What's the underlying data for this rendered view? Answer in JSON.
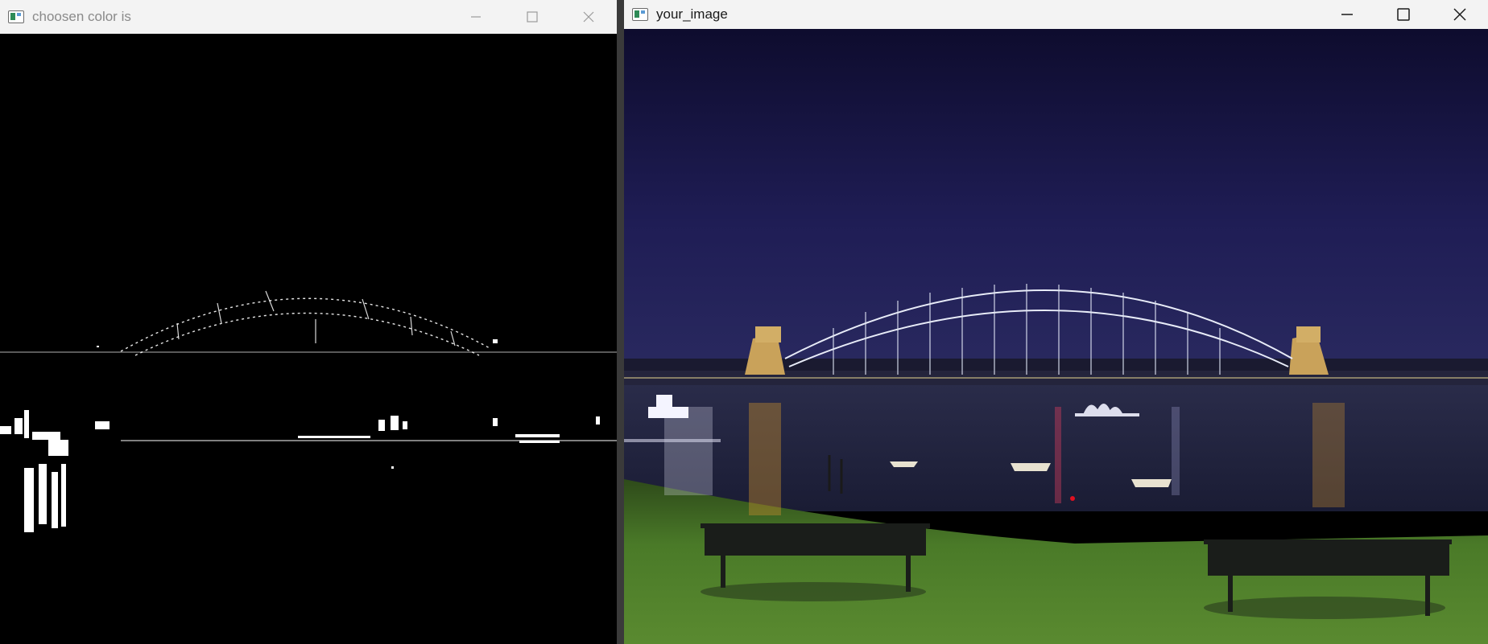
{
  "windows": {
    "mask": {
      "title": "choosen color is",
      "icon": "app-window-icon",
      "controls": [
        "minimize-icon",
        "maximize-icon",
        "close-icon"
      ]
    },
    "image": {
      "title": "your_image",
      "icon": "app-window-icon",
      "controls": [
        "minimize-icon",
        "maximize-icon",
        "close-icon"
      ]
    }
  },
  "colors": {
    "titlebar_bg": "#f3f3f3",
    "mask_bg": "#000000",
    "mask_fg": "#ffffff",
    "sky": "#1a1740",
    "water": "#22243f",
    "grass": "#4d7a2a"
  }
}
